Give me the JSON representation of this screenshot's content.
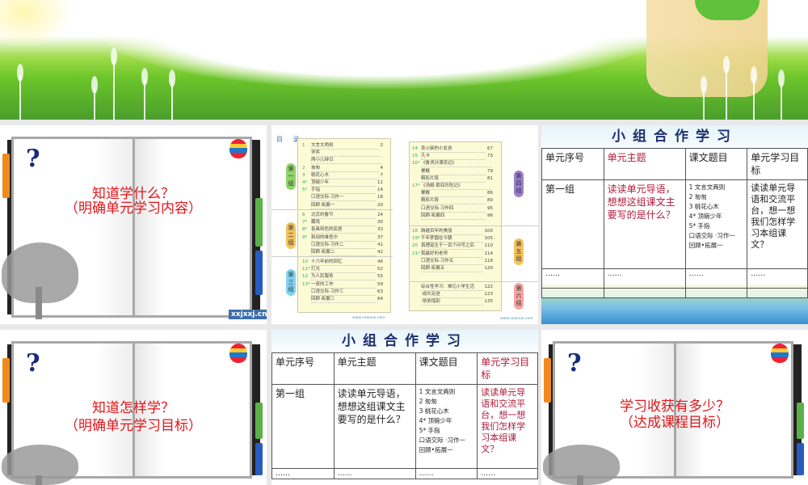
{
  "slides": {
    "book1": {
      "q": "?",
      "line1": "知道学什么？",
      "line2": "（明确单元学习内容）",
      "watermark": "xxjxxj.cn"
    },
    "book2": {
      "q": "?",
      "line1": "知道怎样学？",
      "line2": "（明确单元学习目标）"
    },
    "book3": {
      "q": "?",
      "line1": "学习收获有多少？",
      "line2": "（达成课程目标）"
    }
  },
  "toc": {
    "header": "目 录",
    "url_left": "www.newxue.com",
    "url_right": "www.newxue.com",
    "groups": [
      {
        "label": "第一组",
        "color": "#8fd46a",
        "entries": [
          [
            "1",
            "文言文两则",
            "2"
          ],
          [
            "",
            "学弈",
            ""
          ],
          [
            "",
            "两小儿辩日",
            ""
          ],
          [
            "2",
            "匆匆",
            "4"
          ],
          [
            "3",
            "桃花心木",
            "7"
          ],
          [
            "4*",
            "顶碗少年",
            "11"
          ],
          [
            "5*",
            "手指",
            "14"
          ],
          [
            "",
            "口语交际·习作一",
            "18"
          ],
          [
            "",
            "回顾·拓展一",
            "20"
          ]
        ]
      },
      {
        "label": "第二组",
        "color": "#f3c25a",
        "entries": [
          [
            "6",
            "北京的春节",
            "24"
          ],
          [
            "7*",
            "藏戏",
            "30"
          ],
          [
            "8*",
            "各具特色的民居",
            "33"
          ],
          [
            "9*",
            "和田的维吾尔",
            "37"
          ],
          [
            "",
            "口语交际·习作二",
            "41"
          ],
          [
            "",
            "回顾·拓展二",
            "42"
          ]
        ]
      },
      {
        "label": "第三组",
        "color": "#7fd3f0",
        "entries": [
          [
            "10",
            "十六年前的回忆",
            "46"
          ],
          [
            "11*",
            "灯光",
            "52"
          ],
          [
            "12",
            "为人民服务",
            "55"
          ],
          [
            "13*",
            "一夜的工作",
            "59"
          ],
          [
            "",
            "口语交际·习作三",
            "63"
          ],
          [
            "",
            "回顾·拓展三",
            "64"
          ]
        ]
      },
      {
        "label": "第四组",
        "color": "#9b7fd0",
        "entries": [
          [
            "14",
            "卖火柴的小女孩",
            "67"
          ],
          [
            "15",
            "凡卡",
            "73"
          ],
          [
            "16*",
            "《鲁滨孙漂流记》",
            ""
          ],
          [
            "",
            "梗概",
            "79"
          ],
          [
            "",
            "精彩片段",
            "81"
          ],
          [
            "17*",
            "《汤姆·索亚历险记》",
            ""
          ],
          [
            "",
            "梗概",
            "86"
          ],
          [
            "",
            "精彩片段",
            "89"
          ],
          [
            "",
            "口语交际·习作四",
            "95"
          ],
          [
            "",
            "回顾·拓展四",
            "96"
          ]
        ]
      },
      {
        "label": "第五组",
        "color": "#f3c25a",
        "entries": [
          [
            "18",
            "跨越百年的美丽",
            "100"
          ],
          [
            "19*",
            "千年梦圆在今朝",
            "105"
          ],
          [
            "20",
            "真理诞生于一百个问号之后",
            "110"
          ],
          [
            "21*",
            "我最好的老师",
            "114"
          ],
          [
            "",
            "口语交际·习作五",
            "118"
          ],
          [
            "",
            "回顾·拓展五",
            "120"
          ]
        ]
      },
      {
        "label": "第六组",
        "color": "#f4a6a0",
        "entries": [
          [
            "",
            "综合性学习：难忘小学生活",
            "122"
          ],
          [
            "",
            "·成长足迹",
            "123"
          ],
          [
            "",
            "·依依惜别",
            "135"
          ]
        ]
      }
    ]
  },
  "tables": {
    "title": "小组合作学习",
    "headers": [
      "单元序号",
      "单元主题",
      "课文题目",
      "单元学习目标"
    ],
    "row": {
      "unit": "第一组",
      "theme": "读读单元导语，想想这组课文主要写的是什么？",
      "lessons": [
        "1 文言文两则",
        "2 匆匆",
        "3 桃花心木",
        "4* 顶碗少年",
        "5* 手指",
        "口语交际 ·习作一",
        "回顾•拓展一"
      ],
      "goal": "读读单元导语和交流平台，想一想我们怎样学习本组课文？"
    },
    "ellipsis": "……"
  }
}
